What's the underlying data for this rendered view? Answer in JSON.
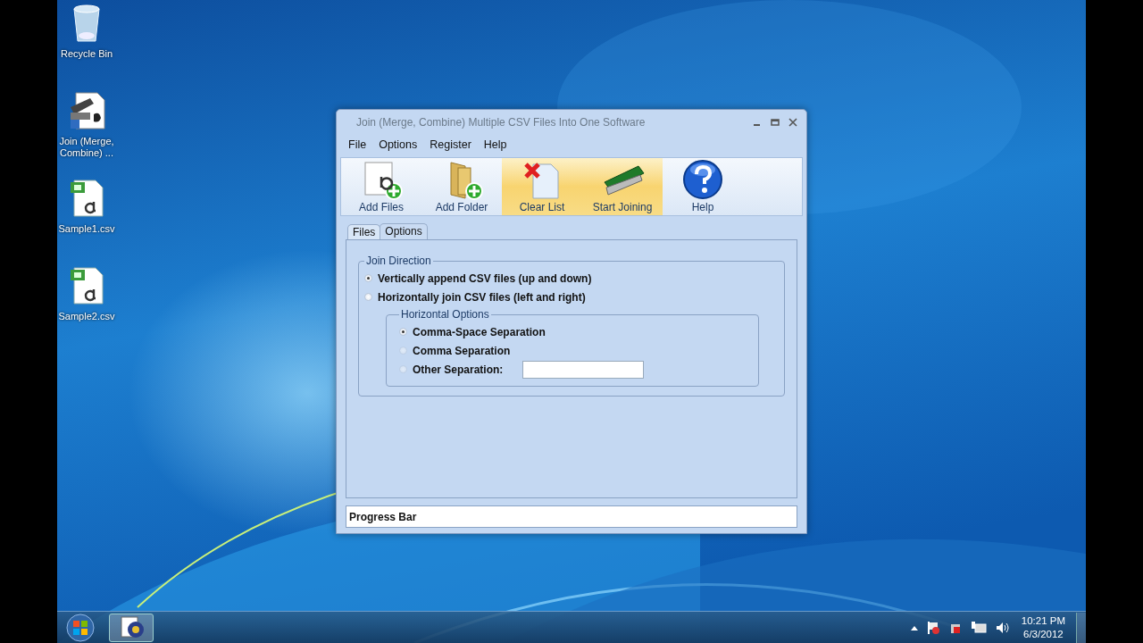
{
  "desktop_icons": [
    {
      "kind": "bin",
      "label": "Recycle Bin"
    },
    {
      "kind": "app",
      "label": "Join (Merge, Combine) ..."
    },
    {
      "kind": "csv",
      "label": "Sample1.csv"
    },
    {
      "kind": "csv",
      "label": "Sample2.csv"
    }
  ],
  "window": {
    "title": "Join (Merge, Combine) Multiple CSV Files Into One Software"
  },
  "menu": [
    "File",
    "Options",
    "Register",
    "Help"
  ],
  "toolbar": [
    {
      "kind": "add-files",
      "label": "Add Files",
      "highlighted": false
    },
    {
      "kind": "add-folder",
      "label": "Add Folder",
      "highlighted": false
    },
    {
      "kind": "clear",
      "label": "Clear List",
      "highlighted": true
    },
    {
      "kind": "join",
      "label": "Start Joining",
      "highlighted": true
    },
    {
      "kind": "help",
      "label": "Help",
      "highlighted": false
    }
  ],
  "tabs": [
    {
      "label": "Files",
      "selected": false
    },
    {
      "label": "Options",
      "selected": true
    }
  ],
  "join_direction": {
    "title": "Join Direction",
    "options": [
      {
        "label": "Vertically append CSV files (up and down)",
        "selected": true
      },
      {
        "label": "Horizontally join CSV files (left and right)",
        "selected": false
      }
    ]
  },
  "horizontal_options": {
    "title": "Horizontal Options",
    "options": [
      {
        "kind": "radio",
        "label": "Comma-Space Separation",
        "selected": true,
        "disabled": false
      },
      {
        "kind": "radio",
        "label": "Comma Separation",
        "selected": false,
        "disabled": true
      },
      {
        "kind": "field",
        "label": "Other Separation:",
        "selected": false,
        "disabled": true
      }
    ]
  },
  "progress_bar": {
    "label": "Progress Bar",
    "level": 0
  },
  "taskbar": {
    "time": "10:21 PM",
    "date": "6/3/2012"
  }
}
